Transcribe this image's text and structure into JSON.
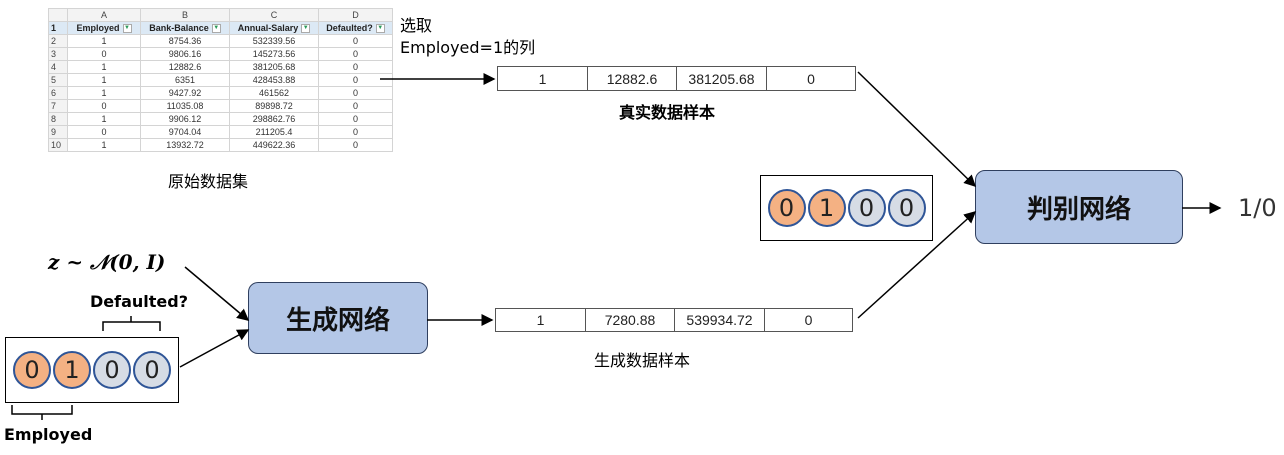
{
  "spreadsheet": {
    "col_letters": [
      "A",
      "B",
      "C",
      "D"
    ],
    "headers": [
      "Employed",
      "Bank-Balance",
      "Annual-Salary",
      "Defaulted?"
    ],
    "rows": [
      {
        "n": "2",
        "v": [
          "1",
          "8754.36",
          "532339.56",
          "0"
        ]
      },
      {
        "n": "3",
        "v": [
          "0",
          "9806.16",
          "145273.56",
          "0"
        ]
      },
      {
        "n": "4",
        "v": [
          "1",
          "12882.6",
          "381205.68",
          "0"
        ]
      },
      {
        "n": "5",
        "v": [
          "1",
          "6351",
          "428453.88",
          "0"
        ]
      },
      {
        "n": "6",
        "v": [
          "1",
          "9427.92",
          "461562",
          "0"
        ]
      },
      {
        "n": "7",
        "v": [
          "0",
          "11035.08",
          "89898.72",
          "0"
        ]
      },
      {
        "n": "8",
        "v": [
          "1",
          "9906.12",
          "298862.76",
          "0"
        ]
      },
      {
        "n": "9",
        "v": [
          "0",
          "9704.04",
          "211205.4",
          "0"
        ]
      },
      {
        "n": "10",
        "v": [
          "1",
          "13932.72",
          "449622.36",
          "0"
        ]
      }
    ],
    "header_row_num": "1",
    "caption": "原始数据集"
  },
  "select_label_line1": "选取",
  "select_label_line2": "Employed=1的列",
  "real_sample": {
    "values": [
      "1",
      "12882.6",
      "381205.68",
      "0"
    ],
    "caption": "真实数据样本"
  },
  "generated_sample": {
    "values": [
      "1",
      "7280.88",
      "539934.72",
      "0"
    ],
    "caption": "生成数据样本"
  },
  "discriminator": {
    "label": "判别网络",
    "output": "1/0"
  },
  "generator": {
    "label": "生成网络"
  },
  "noise_label": "z ~ 𝒩(0, I)",
  "condition_vector": [
    "0",
    "1",
    "0",
    "0"
  ],
  "condition_colors": [
    "#f4b183",
    "#f4b183",
    "#d6dce5",
    "#d6dce5"
  ],
  "defaulted_label": "Defaulted?",
  "employed_label": "Employed"
}
